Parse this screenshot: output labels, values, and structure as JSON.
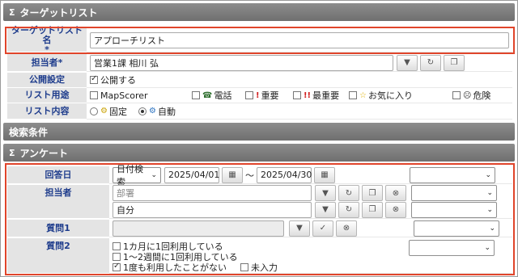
{
  "header": {
    "title": "ターゲットリスト",
    "collapse_icon": "sigma-collapse-icon"
  },
  "target_name": {
    "label": "ターゲットリスト名\n*",
    "value": "アプローチリスト"
  },
  "owner": {
    "label": "担当者*",
    "value": "営業1課 相川 弘"
  },
  "publish": {
    "label": "公開設定",
    "option": "公開する",
    "checked": true
  },
  "usage": {
    "label": "リスト用途",
    "options": [
      {
        "label": "MapScorer",
        "icon": ""
      },
      {
        "label": "電話",
        "icon": "phone-icon"
      },
      {
        "label": "重要",
        "icon": "exclamation-icon"
      },
      {
        "label": "最重要",
        "icon": "double-exclamation-icon"
      },
      {
        "label": "お気に入り",
        "icon": "star-icon"
      },
      {
        "label": "危険",
        "icon": "sad-face-icon"
      }
    ]
  },
  "content": {
    "label": "リスト内容",
    "options": [
      {
        "label": "固定",
        "selected": false,
        "icon": "gear-icon"
      },
      {
        "label": "自動",
        "selected": true,
        "icon": "auto-icon"
      }
    ]
  },
  "search_section": {
    "title": "検索条件"
  },
  "survey_section": {
    "title": "アンケート"
  },
  "answer_date": {
    "label": "回答日",
    "mode": "日付検索",
    "from": "2025/04/01",
    "separator": "〜",
    "to": "2025/04/30"
  },
  "survey_owner": {
    "label": "担当者",
    "dept_placeholder": "部署",
    "person_value": "自分"
  },
  "question1": {
    "label": "質問1"
  },
  "question2": {
    "label": "質問2",
    "options": [
      {
        "label": "1カ月に1回利用している",
        "checked": false
      },
      {
        "label": "1〜2週間に1回利用している",
        "checked": false
      },
      {
        "label": "1度も利用したことがない",
        "checked": true
      },
      {
        "label": "未入力",
        "checked": false
      }
    ]
  }
}
